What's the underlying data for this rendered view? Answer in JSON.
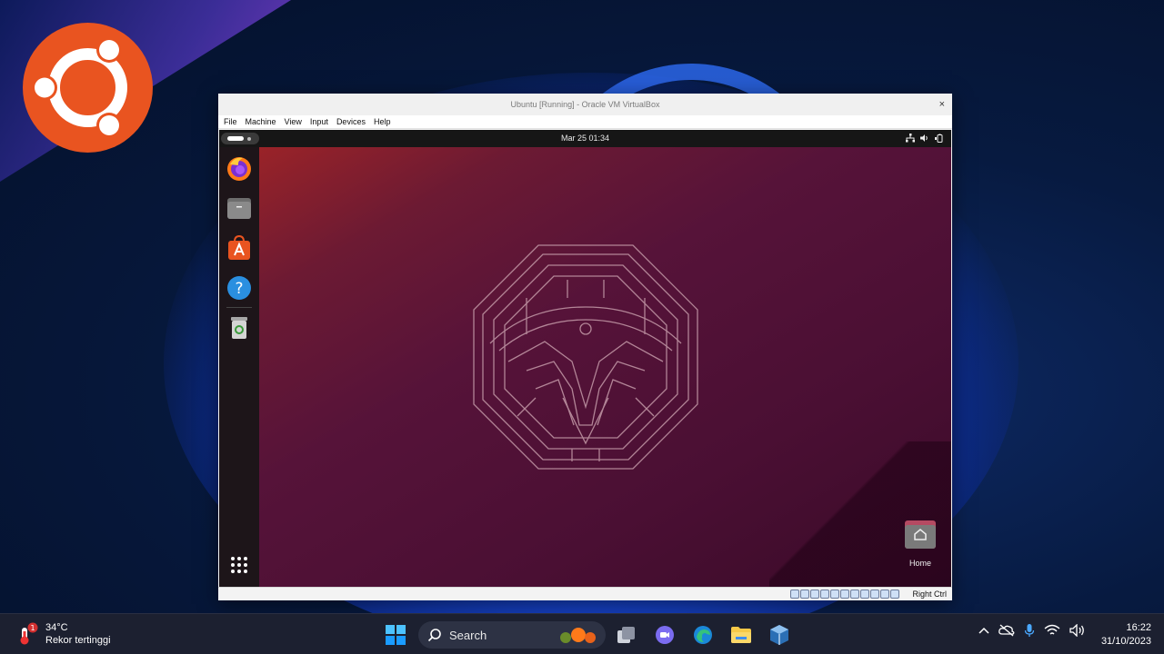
{
  "vm_window": {
    "title": "Ubuntu [Running] - Oracle VM VirtualBox",
    "close_glyph": "×",
    "menu": [
      "File",
      "Machine",
      "View",
      "Input",
      "Devices",
      "Help"
    ],
    "host_key": "Right Ctrl"
  },
  "guest": {
    "clock": "Mar 25  01:34",
    "dock": [
      {
        "name": "firefox-icon"
      },
      {
        "name": "files-icon"
      },
      {
        "name": "app-center-icon"
      },
      {
        "name": "help-icon"
      },
      {
        "name": "trash-icon"
      }
    ],
    "desktop_icon_label": "Home",
    "colors": {
      "accent": "#e95420",
      "wallpaper": "#4a0f33"
    }
  },
  "taskbar": {
    "weather_temp": "34°C",
    "weather_sub": "Rekor tertinggi",
    "weather_badge": "1",
    "search_label": "Search",
    "time": "16:22",
    "date": "31/10/2023"
  }
}
